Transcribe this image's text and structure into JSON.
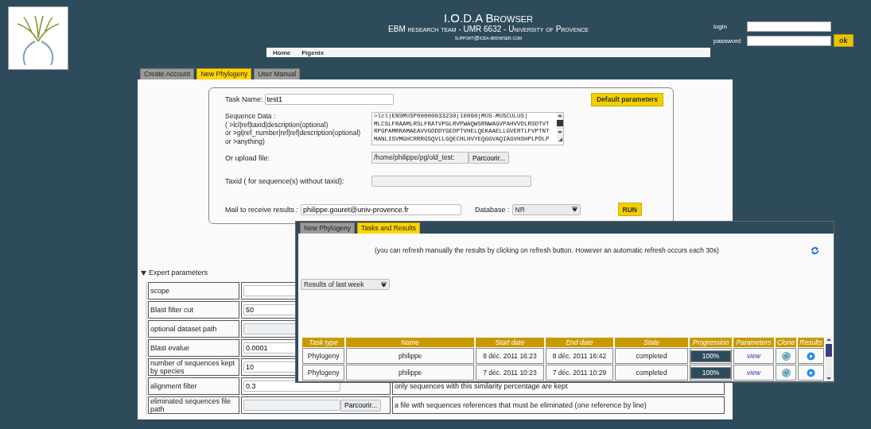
{
  "header": {
    "title": "I.O.D.A Browser",
    "subtitle": "EBM research team - UMR 6632 - University of Provence",
    "email": "support@ioda-browser.com"
  },
  "login": {
    "login_label": "login",
    "password_label": "password",
    "ok": "ok"
  },
  "nav": [
    "Home",
    "Figenix"
  ],
  "tabs": [
    {
      "label": "Create Account",
      "selected": false
    },
    {
      "label": "New Phylogeny",
      "selected": true
    },
    {
      "label": "User Manual",
      "selected": false
    }
  ],
  "form": {
    "task_name_label": "Task Name:",
    "task_name": "test1",
    "default_button": "Default parameters",
    "sequence_labels": [
      "Sequence Data :",
      "( >lcl|ref|taxid|description(optional)",
      "or >gi|ref_number|ref|ref|description(optional)",
      "or >anything)"
    ],
    "sequence_lines": [
      ">lcl|ENSMUSP00000033230|10090|MUS-MUSCULUS|",
      "MLCSLFRAAMLRSLFRATVPGLRVPWAQWSRNWAGVPAHVVDLRSDTVT",
      "RPGPAMRRAMAEAVVGDDDYGEDPTVHELQEKAAELLGVERTLFVPTNT",
      "MANLISVMGHCRRRGSQVLLGQECHLHVYEQGGVAQIAGVHSHPLPDLP"
    ],
    "upload_label": "Or upload file:",
    "upload_value": "/home/philippe/pg/old_test:",
    "browse": "Parcourir...",
    "taxid_label": "Taxid ( for sequence(s) without taxid):",
    "mail_label": "Mail to receive results :",
    "mail": "philippe.gouret@univ-provence.fr",
    "database_label": "Database :",
    "database": "NR",
    "run": "RUN"
  },
  "expert": {
    "label": "Expert parameters",
    "expanded": true,
    "rows": [
      {
        "label": "scope",
        "kind": "text",
        "disabled": false
      },
      {
        "label": "Blast filter cut",
        "kind": "text",
        "value": "50",
        "disabled": false
      },
      {
        "label": "optional dataset path",
        "kind": "text",
        "disabled": true
      },
      {
        "label": "Blast evalue",
        "kind": "text",
        "value": "0.0001",
        "disabled": false
      },
      {
        "label": "number of sequences kept by species",
        "kind": "text",
        "value": "10",
        "disabled": false
      },
      {
        "label": "alignment filter",
        "kind": "text",
        "value": "0.3",
        "disabled": false,
        "description": "only sequences with this similarity percentage are kept"
      },
      {
        "label": "eliminated sequences file path",
        "kind": "file",
        "browse": "Parcourir...",
        "disabled": true,
        "description": "a file with sequences references that must be eliminated (one reference by line)"
      }
    ]
  },
  "results": {
    "tabs": [
      {
        "label": "New Phylogeny",
        "selected": false
      },
      {
        "label": "Tasks and Results",
        "selected": true
      }
    ],
    "note": "(you can refresh manually the results by clicking on refresh button. However an automatic refresh occurs each 30s)",
    "period": "Results of last week",
    "columns": [
      "Task type",
      "Name",
      "Start date",
      "End date",
      "State",
      "Progression",
      "Parameters",
      "Clone",
      "Results"
    ],
    "rows": [
      {
        "type": "Phylogeny",
        "name": "philippe",
        "start": "8 déc. 2011 16:23",
        "end": "8 déc. 2011 16:42",
        "state": "completed",
        "level": 1,
        "progress": "100%",
        "parameters": "view"
      },
      {
        "type": "Phylogeny",
        "name": "philippe",
        "start": "7 déc. 2011 10:23",
        "end": "7 déc. 2011 10:29",
        "state": "completed",
        "level": 1,
        "progress": "100%",
        "parameters": "view"
      }
    ]
  }
}
